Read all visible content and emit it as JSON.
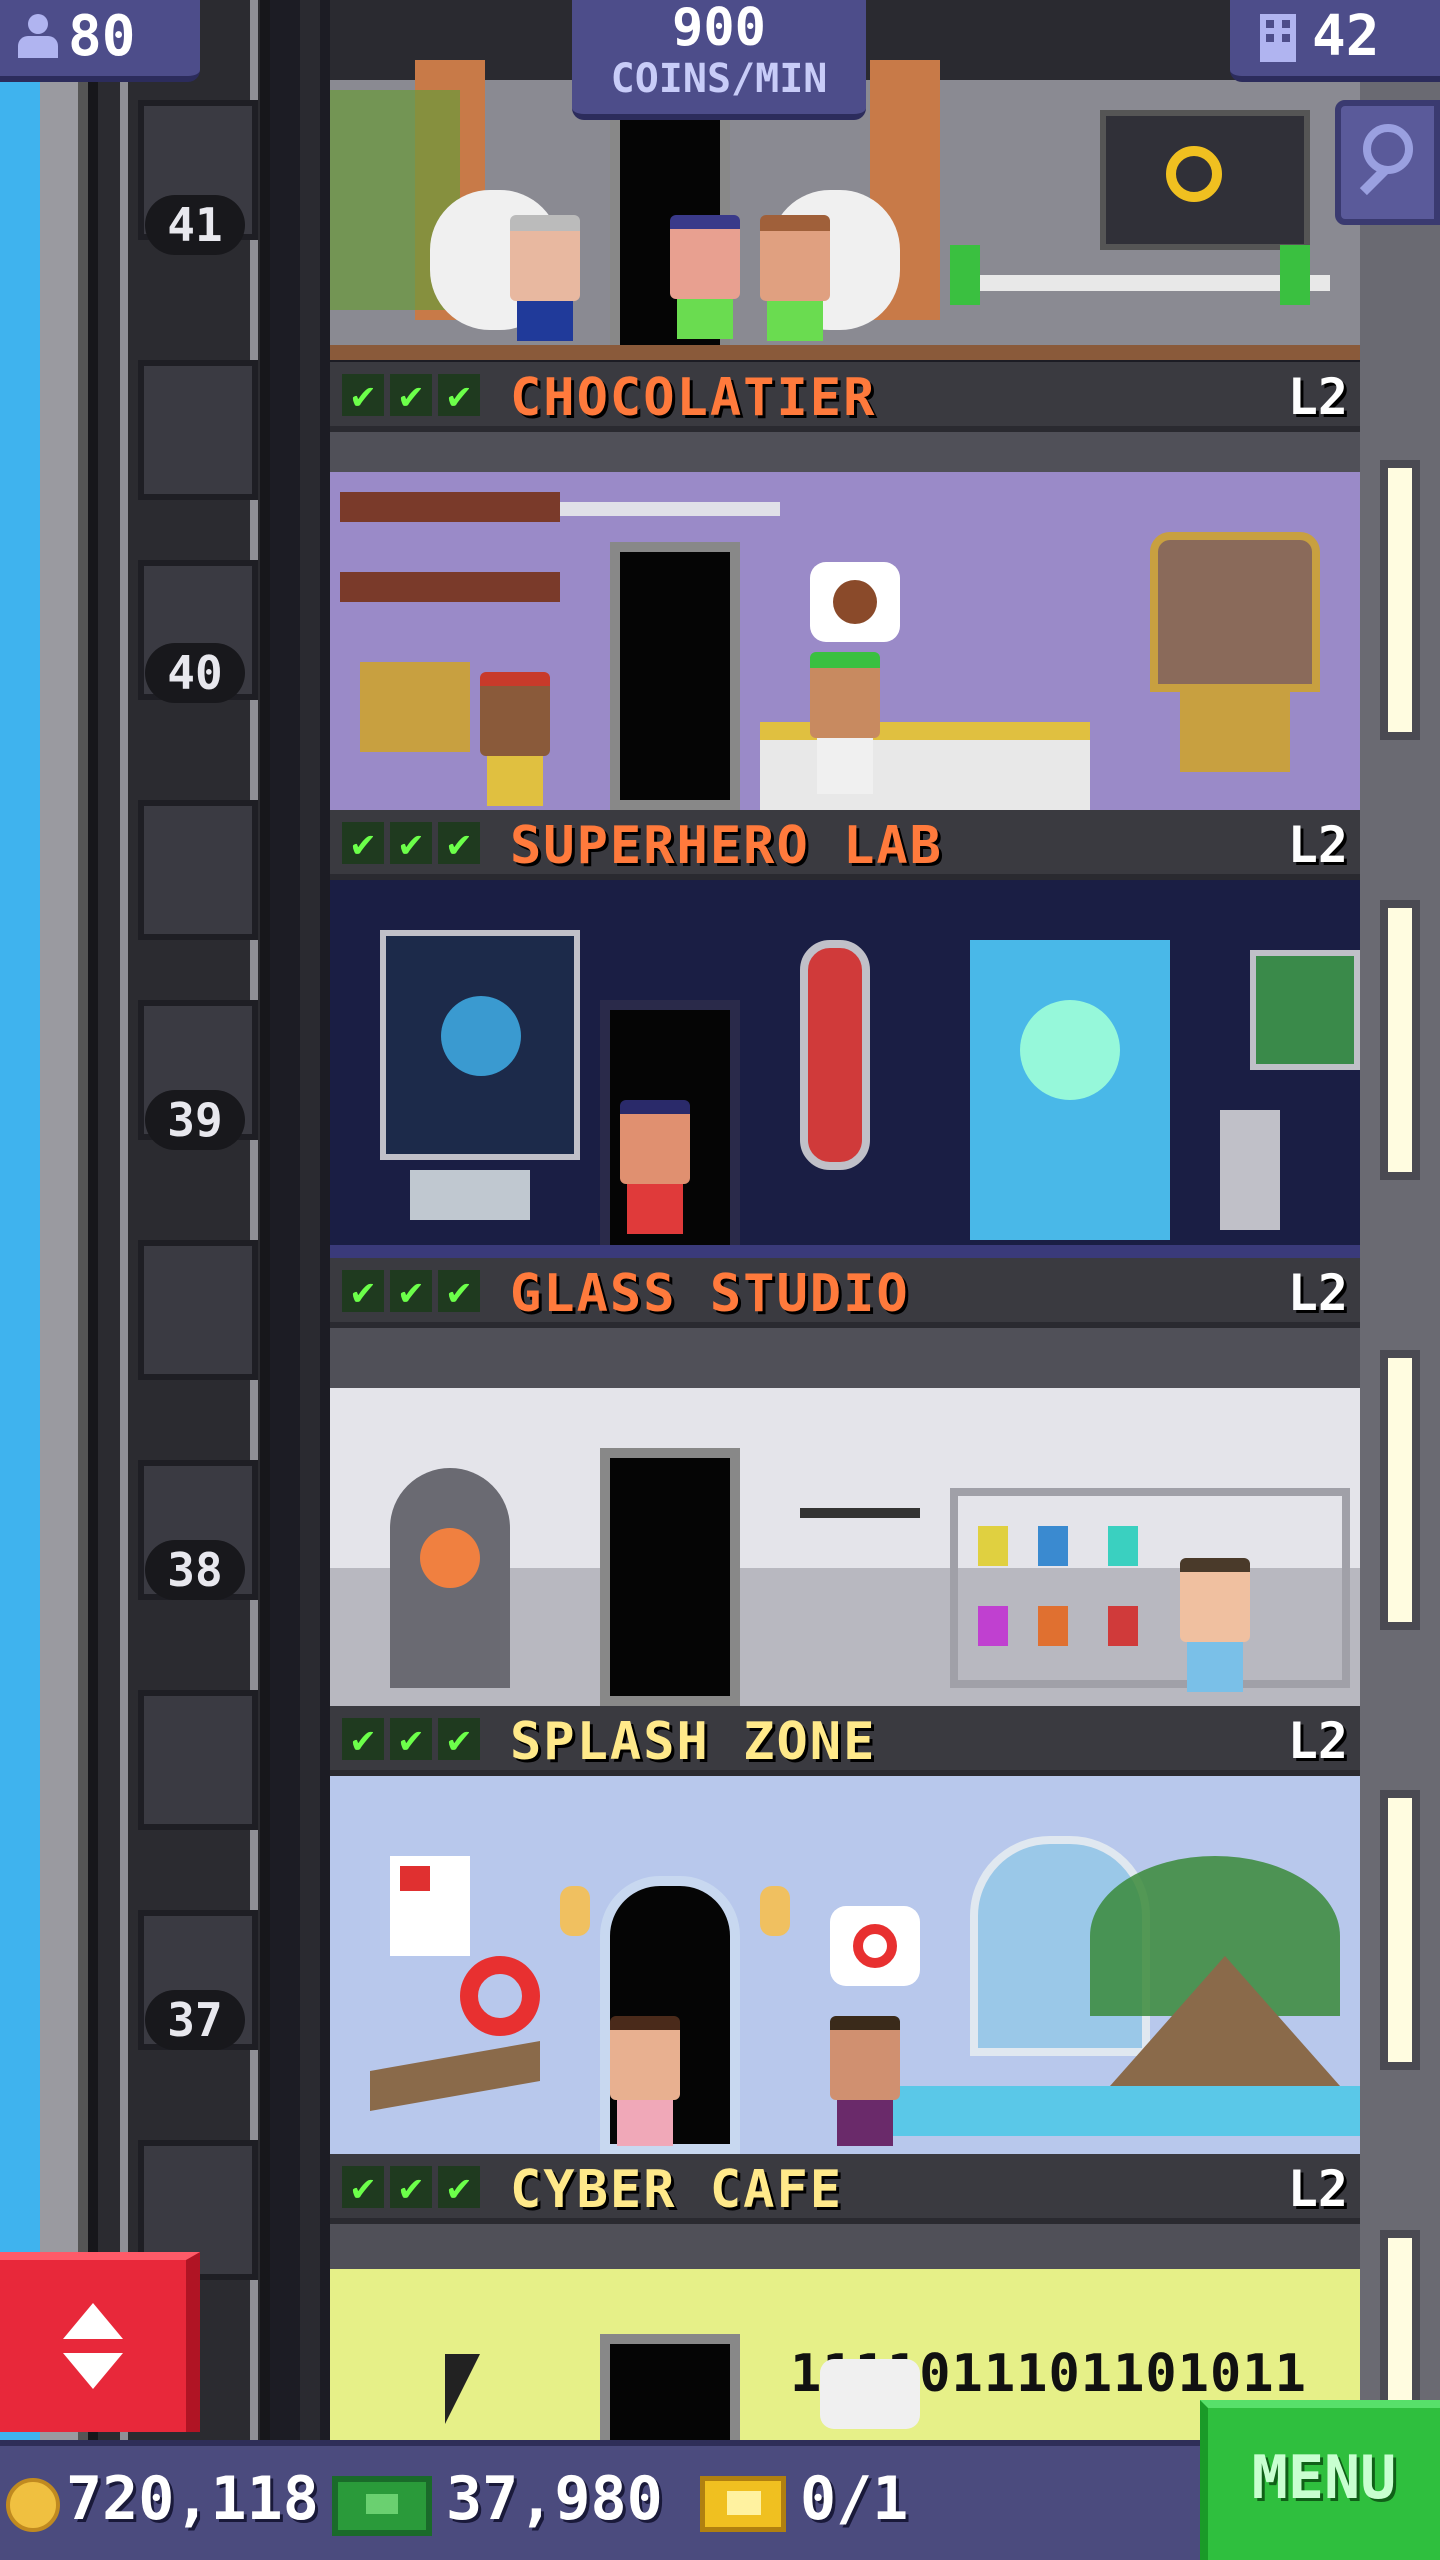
{
  "hud": {
    "population": "80",
    "coins_per_min_value": "900",
    "coins_per_min_label": "COINS/MIN",
    "floors_count": "42"
  },
  "shaft": {
    "floor_numbers": [
      "41",
      "40",
      "39",
      "38",
      "37"
    ]
  },
  "floors": [
    {
      "name": "CHOCOLATIER",
      "level": "L2",
      "name_color": "#ff7a3c"
    },
    {
      "name": "SUPERHERO LAB",
      "level": "L2",
      "name_color": "#ff7a3c"
    },
    {
      "name": "GLASS STUDIO",
      "level": "L2",
      "name_color": "#ff7a3c"
    },
    {
      "name": "SPLASH ZONE",
      "level": "L2",
      "name_color": "#ffe98a"
    },
    {
      "name": "CYBER CAFE",
      "level": "L2",
      "name_color": "#ffe98a"
    }
  ],
  "check_glyph": "✔",
  "cyber_cafe_binary": "1111011101101011",
  "bottom": {
    "coins": "720,118",
    "bux": "37,980",
    "tickets": "0/1",
    "menu_label": "MENU"
  },
  "icons": {
    "population": "person-icon",
    "floors": "building-icon",
    "search": "magnifier-icon",
    "coin": "coin-icon",
    "bux": "bux-icon",
    "ticket": "ticket-icon",
    "elevator": "elevator-updown-icon"
  },
  "colors": {
    "hud_bg": "#4d4d8a",
    "menu_green": "#2fbf3e",
    "elevator_red": "#e8283a",
    "check_green": "#6cff4a"
  }
}
